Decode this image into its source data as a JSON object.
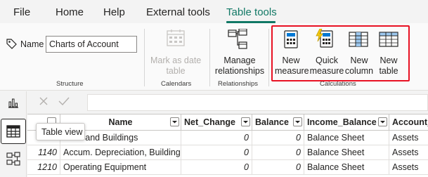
{
  "tabs": [
    "File",
    "Home",
    "Help",
    "External tools",
    "Table tools"
  ],
  "active_tab": "Table tools",
  "accent_color": "#117865",
  "highlight_color": "#e81123",
  "structure": {
    "name_label": "Name",
    "name_value": "Charts of Account",
    "group_label": "Structure"
  },
  "calendars": {
    "mark_as_date_line1": "Mark as date",
    "mark_as_date_line2": "table",
    "group_label": "Calendars"
  },
  "relationships": {
    "manage_line1": "Manage",
    "manage_line2": "relationships",
    "group_label": "Relationships"
  },
  "calculations": {
    "new_measure": [
      "New",
      "measure"
    ],
    "quick_measure": [
      "Quick",
      "measure"
    ],
    "new_column": [
      "New",
      "column"
    ],
    "new_table": [
      "New",
      "table"
    ],
    "group_label": "Calculations"
  },
  "tooltip": "Table view",
  "table": {
    "columns": [
      "Name",
      "Net_Change",
      "Balance",
      "Income_Balance",
      "Account_"
    ],
    "rows": [
      {
        "code": "",
        "name": "Land and Buildings",
        "net_change": "0",
        "balance": "0",
        "income_balance": "Balance Sheet",
        "account": "Assets"
      },
      {
        "code": "1140",
        "name": "Accum. Depreciation, Buildings",
        "net_change": "0",
        "balance": "0",
        "income_balance": "Balance Sheet",
        "account": "Assets"
      },
      {
        "code": "1210",
        "name": "Operating Equipment",
        "net_change": "0",
        "balance": "0",
        "income_balance": "Balance Sheet",
        "account": "Assets"
      }
    ]
  }
}
